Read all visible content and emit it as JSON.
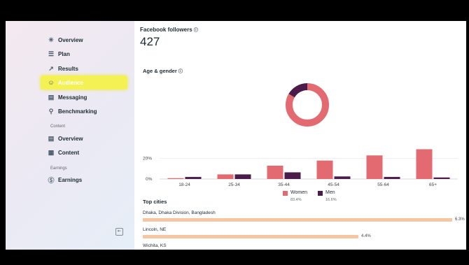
{
  "sidebar": {
    "items": [
      {
        "label": "Overview",
        "icon": "overview-icon"
      },
      {
        "label": "Plan",
        "icon": "plan-icon"
      },
      {
        "label": "Results",
        "icon": "results-icon"
      },
      {
        "label": "Audience",
        "icon": "audience-icon"
      },
      {
        "label": "Messaging",
        "icon": "messaging-icon"
      },
      {
        "label": "Benchmarking",
        "icon": "benchmarking-icon"
      }
    ],
    "content_label": "Content",
    "content_items": [
      {
        "label": "Overview",
        "icon": "content-overview-icon"
      },
      {
        "label": "Content",
        "icon": "content-grid-icon"
      }
    ],
    "earnings_label": "Earnings",
    "earnings_items": [
      {
        "label": "Earnings",
        "icon": "earnings-icon"
      }
    ],
    "highlight_color": "#f6f33a"
  },
  "followers": {
    "title": "Facebook followers",
    "count": "427"
  },
  "age_gender": {
    "title": "Age & gender"
  },
  "chart_data": {
    "type": "bar",
    "categories": [
      "18-24",
      "25-34",
      "35-44",
      "45-54",
      "55-64",
      "65+"
    ],
    "series": [
      {
        "name": "Women",
        "color": "#e36a70",
        "values": [
          0.5,
          4.5,
          13,
          18,
          23,
          29
        ]
      },
      {
        "name": "Men",
        "color": "#4b1b4a",
        "values": [
          2,
          4.5,
          6.5,
          2.5,
          2,
          1.5
        ]
      }
    ],
    "ylim": [
      0,
      30
    ],
    "y_ticks": [
      "20%",
      "0%"
    ],
    "legend": [
      {
        "name": "Women",
        "pct": "83.4%"
      },
      {
        "name": "Men",
        "pct": "16.6%"
      }
    ],
    "donut": [
      {
        "name": "Women",
        "value": 83.4,
        "color": "#e36a70"
      },
      {
        "name": "Men",
        "value": 16.6,
        "color": "#4b1b4a"
      }
    ]
  },
  "top_cities": {
    "title": "Top cities",
    "cities": [
      {
        "name": "Dhaka, Dhaka Division, Bangladesh",
        "value": "6.3%",
        "fraction": 1.0
      },
      {
        "name": "Lincoln, NE",
        "value": "4.4%",
        "fraction": 0.698
      },
      {
        "name": "Wichita, KS"
      }
    ]
  }
}
